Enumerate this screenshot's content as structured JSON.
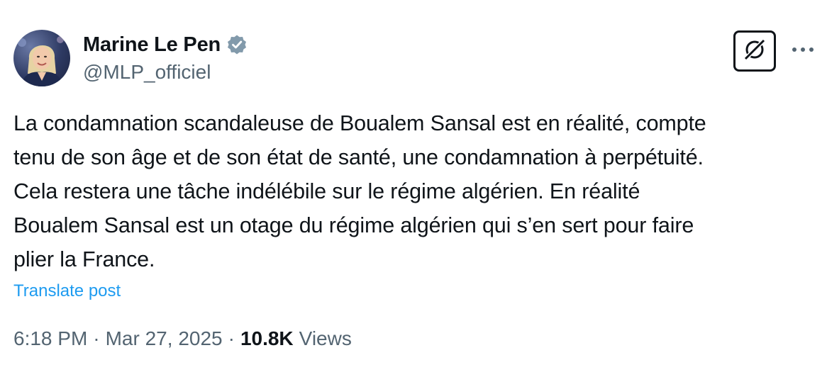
{
  "author": {
    "display_name": "Marine Le Pen",
    "handle": "@MLP_officiel",
    "verified": true,
    "avatar_icon": "profile-photo"
  },
  "actions": {
    "grok_icon": "grok-icon",
    "more_icon": "more-horizontal-icon"
  },
  "post": {
    "text": "La condamnation scandaleuse de Boualem Sansal est en réalité, compte\ntenu de son âge et de son état de santé, une condamnation à perpétuité.\nCela restera une tâche indélébile sur le régime algérien. En réalité\nBoualem Sansal est un otage du régime algérien qui s’en sert pour faire\nplier la France.",
    "translate_label": "Translate post"
  },
  "meta": {
    "time": "6:18 PM",
    "separator": "·",
    "date": "Mar 27, 2025",
    "views_count": "10.8K",
    "views_label": "Views"
  },
  "colors": {
    "text": "#0f1419",
    "secondary": "#536471",
    "link": "#1d9bf0",
    "verified_badge": "#829aab"
  }
}
